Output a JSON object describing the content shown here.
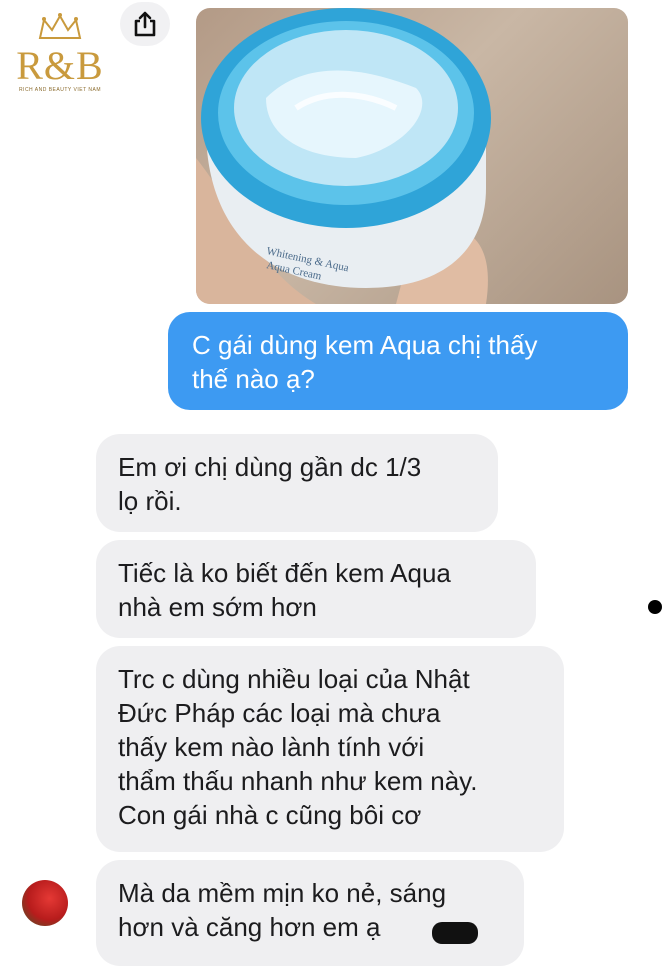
{
  "logo": {
    "text": "R&B",
    "tagline": "RICH AND BEAUTY VIET NAM",
    "color": "#c99a3d"
  },
  "toolbar": {
    "share_icon": "share-icon"
  },
  "photo": {
    "jar_label": "Whitening & Aqua Aqua Cream",
    "description_color_lid": "#3aaed8"
  },
  "messages": {
    "outgoing": [
      {
        "text": "C gái dùng kem Aqua chị thấy\nthế nào ạ?"
      }
    ],
    "incoming": [
      {
        "text": "Em ơi chị dùng gần dc 1/3\nlọ rồi."
      },
      {
        "text": "Tiếc là ko biết đến kem Aqua\nnhà em sớm hơn"
      },
      {
        "text": "Trc c dùng nhiều loại của Nhật\nĐức Pháp các loại mà chưa\nthấy kem nào lành tính với\nthẩm thấu nhanh như kem này.\nCon gái nhà c cũng bôi cơ"
      },
      {
        "text": "Mà da mềm mịn ko nẻ, sáng\nhơn và căng hơn em ạ"
      }
    ]
  },
  "colors": {
    "outgoing_bubble": "#3d9af2",
    "incoming_bubble": "#efeff1"
  }
}
